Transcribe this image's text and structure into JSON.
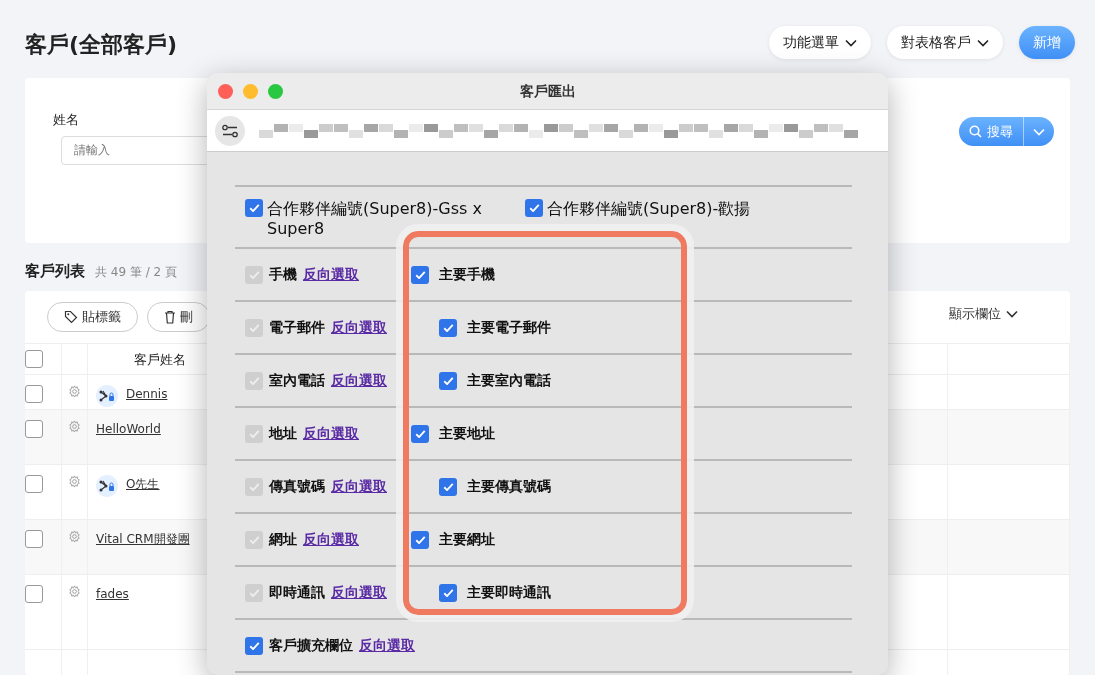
{
  "page": {
    "title": "客戶(全部客戶)",
    "actions": [
      {
        "label": "功能選單",
        "kind": "dropdown"
      },
      {
        "label": "對表格客戶",
        "kind": "dropdown"
      },
      {
        "label": "新增",
        "kind": "primary"
      }
    ]
  },
  "search": {
    "fields": [
      {
        "label": "姓名",
        "placeholder": "請輸入"
      }
    ],
    "button": "搜尋"
  },
  "list": {
    "title": "客戶列表",
    "summary": "共 49 筆 / 2 頁",
    "toolbar": [
      {
        "label": "貼標籤"
      },
      {
        "label": "刪"
      }
    ],
    "select_all": false,
    "columns_button": "顯示欄位",
    "columns": [
      "客戶姓名"
    ],
    "rows": [
      {
        "name": "Dennis",
        "linked": true,
        "checked": false
      },
      {
        "name": "HelloWorld",
        "linked": false,
        "checked": false
      },
      {
        "name": "O先生",
        "linked": true,
        "checked": false
      },
      {
        "name": "Vital CRM開發團",
        "linked": false,
        "checked": false
      },
      {
        "name": "fades",
        "linked": false,
        "checked": false
      }
    ]
  },
  "dialog": {
    "title": "客戶匯出",
    "rows": [
      {
        "kind": "pair",
        "items": [
          {
            "label": "合作夥伴編號(Super8)-Gss x Super8",
            "checked": true
          },
          {
            "label": "合作夥伴編號(Super8)-歡揚",
            "checked": true
          }
        ]
      },
      {
        "kind": "field",
        "label": "手機",
        "link": "反向選取",
        "checked": true,
        "disabled": true,
        "primary": {
          "label": "主要手機",
          "checked": true
        }
      },
      {
        "kind": "field",
        "label": "電子郵件",
        "link": "反向選取",
        "checked": true,
        "disabled": true,
        "primary": {
          "label": "主要電子郵件",
          "checked": true
        }
      },
      {
        "kind": "field",
        "label": "室內電話",
        "link": "反向選取",
        "checked": true,
        "disabled": true,
        "primary": {
          "label": "主要室內電話",
          "checked": true
        }
      },
      {
        "kind": "field",
        "label": "地址",
        "link": "反向選取",
        "checked": true,
        "disabled": true,
        "primary": {
          "label": "主要地址",
          "checked": true
        }
      },
      {
        "kind": "field",
        "label": "傳真號碼",
        "link": "反向選取",
        "checked": true,
        "disabled": true,
        "primary": {
          "label": "主要傳真號碼",
          "checked": true
        }
      },
      {
        "kind": "field",
        "label": "網址",
        "link": "反向選取",
        "checked": true,
        "disabled": true,
        "primary": {
          "label": "主要網址",
          "checked": true
        }
      },
      {
        "kind": "field",
        "label": "即時通訊",
        "link": "反向選取",
        "checked": true,
        "disabled": true,
        "primary": {
          "label": "主要即時通訊",
          "checked": true
        }
      },
      {
        "kind": "field",
        "label": "客戶擴充欄位",
        "link": "反向選取",
        "checked": true,
        "disabled": false
      }
    ]
  }
}
